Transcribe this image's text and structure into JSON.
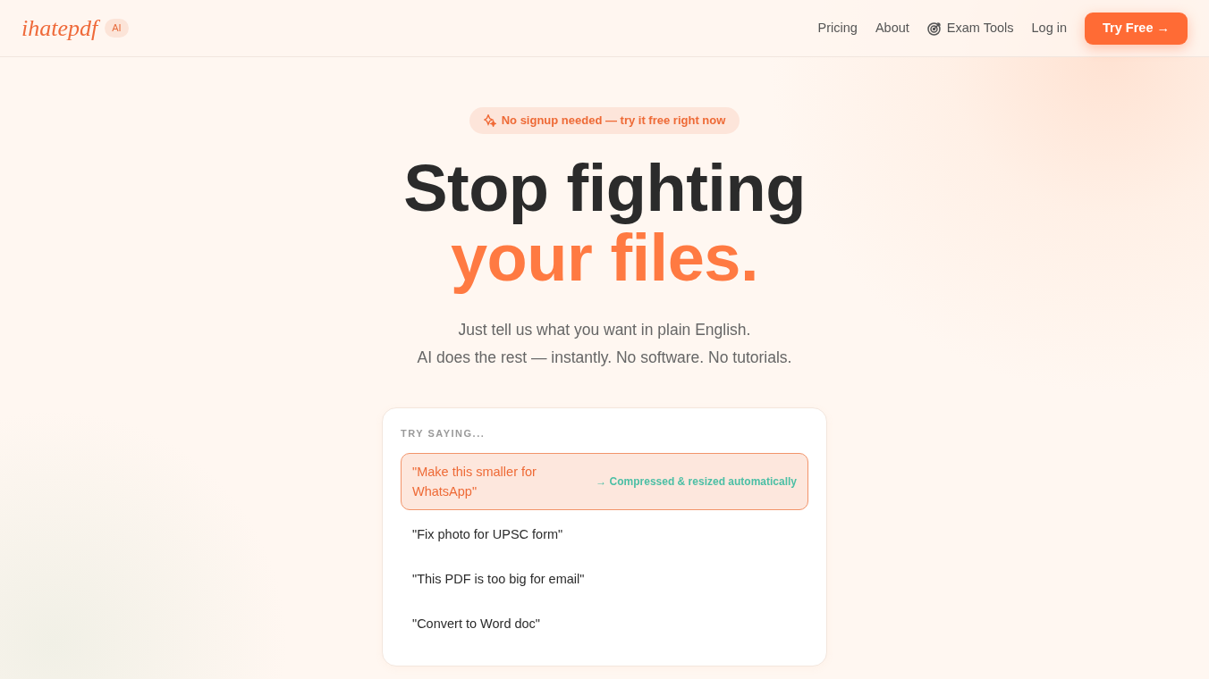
{
  "header": {
    "logo": "ihatepdf",
    "logo_badge": "AI",
    "nav": [
      {
        "label": "Pricing",
        "kind": "link"
      },
      {
        "label": "About",
        "kind": "link"
      },
      {
        "label": "Exam Tools",
        "kind": "icon_link"
      },
      {
        "label": "Log in",
        "kind": "link"
      }
    ],
    "cta": "Try Free →"
  },
  "hero": {
    "badge": "No signup needed — try it free right now",
    "headline": "Stop fighting",
    "headline_accent": "your files.",
    "subtitle": [
      "Just tell us what you want in plain English.",
      "AI does the rest — instantly. No software. No tutorials."
    ]
  },
  "examples_card": {
    "label": "TRY SAYING...",
    "examples": [
      {
        "text": "\"Make this smaller for WhatsApp\"",
        "selected": true,
        "result": "→ Compressed & resized automatically"
      },
      {
        "text": "\"Fix photo for UPSC form\"",
        "selected": false
      },
      {
        "text": "\"This PDF is too big for email\"",
        "selected": false
      },
      {
        "text": "\"Convert to Word doc\"",
        "selected": false
      }
    ]
  }
}
